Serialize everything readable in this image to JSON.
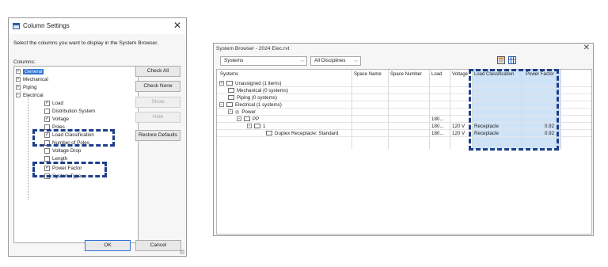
{
  "dialog": {
    "title": "Column Settings",
    "instruction": "Select the columns you want to display in the System Browser.",
    "columns_label": "Columns:",
    "tree": [
      {
        "label": "General",
        "kind": "group",
        "expander": "+",
        "selected": true
      },
      {
        "label": "Mechanical",
        "kind": "group",
        "expander": "+"
      },
      {
        "label": "Piping",
        "kind": "group",
        "expander": "+"
      },
      {
        "label": "Electrical",
        "kind": "group",
        "expander": "−"
      },
      {
        "label": "Load",
        "kind": "item",
        "checked": true
      },
      {
        "label": "Distribution System",
        "kind": "item",
        "checked": false
      },
      {
        "label": "Voltage",
        "kind": "item",
        "checked": true
      },
      {
        "label": "Poles",
        "kind": "item",
        "checked": false
      },
      {
        "label": "Load Classification",
        "kind": "item",
        "checked": true
      },
      {
        "label": "Number of Poles",
        "kind": "item",
        "checked": false
      },
      {
        "label": "Voltage Drop",
        "kind": "item",
        "checked": false
      },
      {
        "label": "Length",
        "kind": "item",
        "checked": false
      },
      {
        "label": "Power Factor",
        "kind": "item",
        "checked": true
      },
      {
        "label": "System Type",
        "kind": "item",
        "checked": false
      }
    ],
    "buttons": {
      "check_all": "Check All",
      "check_none": "Check None",
      "show": "Show",
      "hide": "Hide",
      "restore": "Restore Defaults",
      "ok": "OK",
      "cancel": "Cancel"
    }
  },
  "browser": {
    "title": "System Browser - 2024 Elec.rvt",
    "view_select": "Systems",
    "discipline_select": "All Disciplines",
    "columns": [
      "Systems",
      "Space Name",
      "Space Number",
      "Load",
      "Voltage",
      "Load Classification",
      "Power Factor"
    ],
    "rows": [
      {
        "expander": "+",
        "name": "Unassigned (1 items)",
        "load": "",
        "voltage": "",
        "classification": "",
        "pf": ""
      },
      {
        "expander": "",
        "name": "Mechanical (0 systems)",
        "load": "",
        "voltage": "",
        "classification": "",
        "pf": ""
      },
      {
        "expander": "",
        "name": "Piping (0 systems)",
        "load": "",
        "voltage": "",
        "classification": "",
        "pf": ""
      },
      {
        "expander": "−",
        "name": "Electrical (1 systems)",
        "load": "",
        "voltage": "",
        "classification": "",
        "pf": ""
      },
      {
        "expander": "−",
        "name": "Power",
        "load": "",
        "voltage": "",
        "classification": "",
        "pf": ""
      },
      {
        "expander": "−",
        "name": "PP",
        "load": "180...",
        "voltage": "",
        "classification": "",
        "pf": ""
      },
      {
        "expander": "−",
        "name": "1",
        "load": "180...",
        "voltage": "120 V",
        "classification": "Receptacle",
        "pf": "0.92"
      },
      {
        "expander": "",
        "name": "Duplex Receptacle: Standard",
        "load": "180...",
        "voltage": "120 V",
        "classification": "Receptacle",
        "pf": "0.92"
      }
    ]
  },
  "colors": {
    "highlight": "#1d3f8a",
    "selection": "#2f73d4",
    "column_shade": "#cfe3f7"
  }
}
